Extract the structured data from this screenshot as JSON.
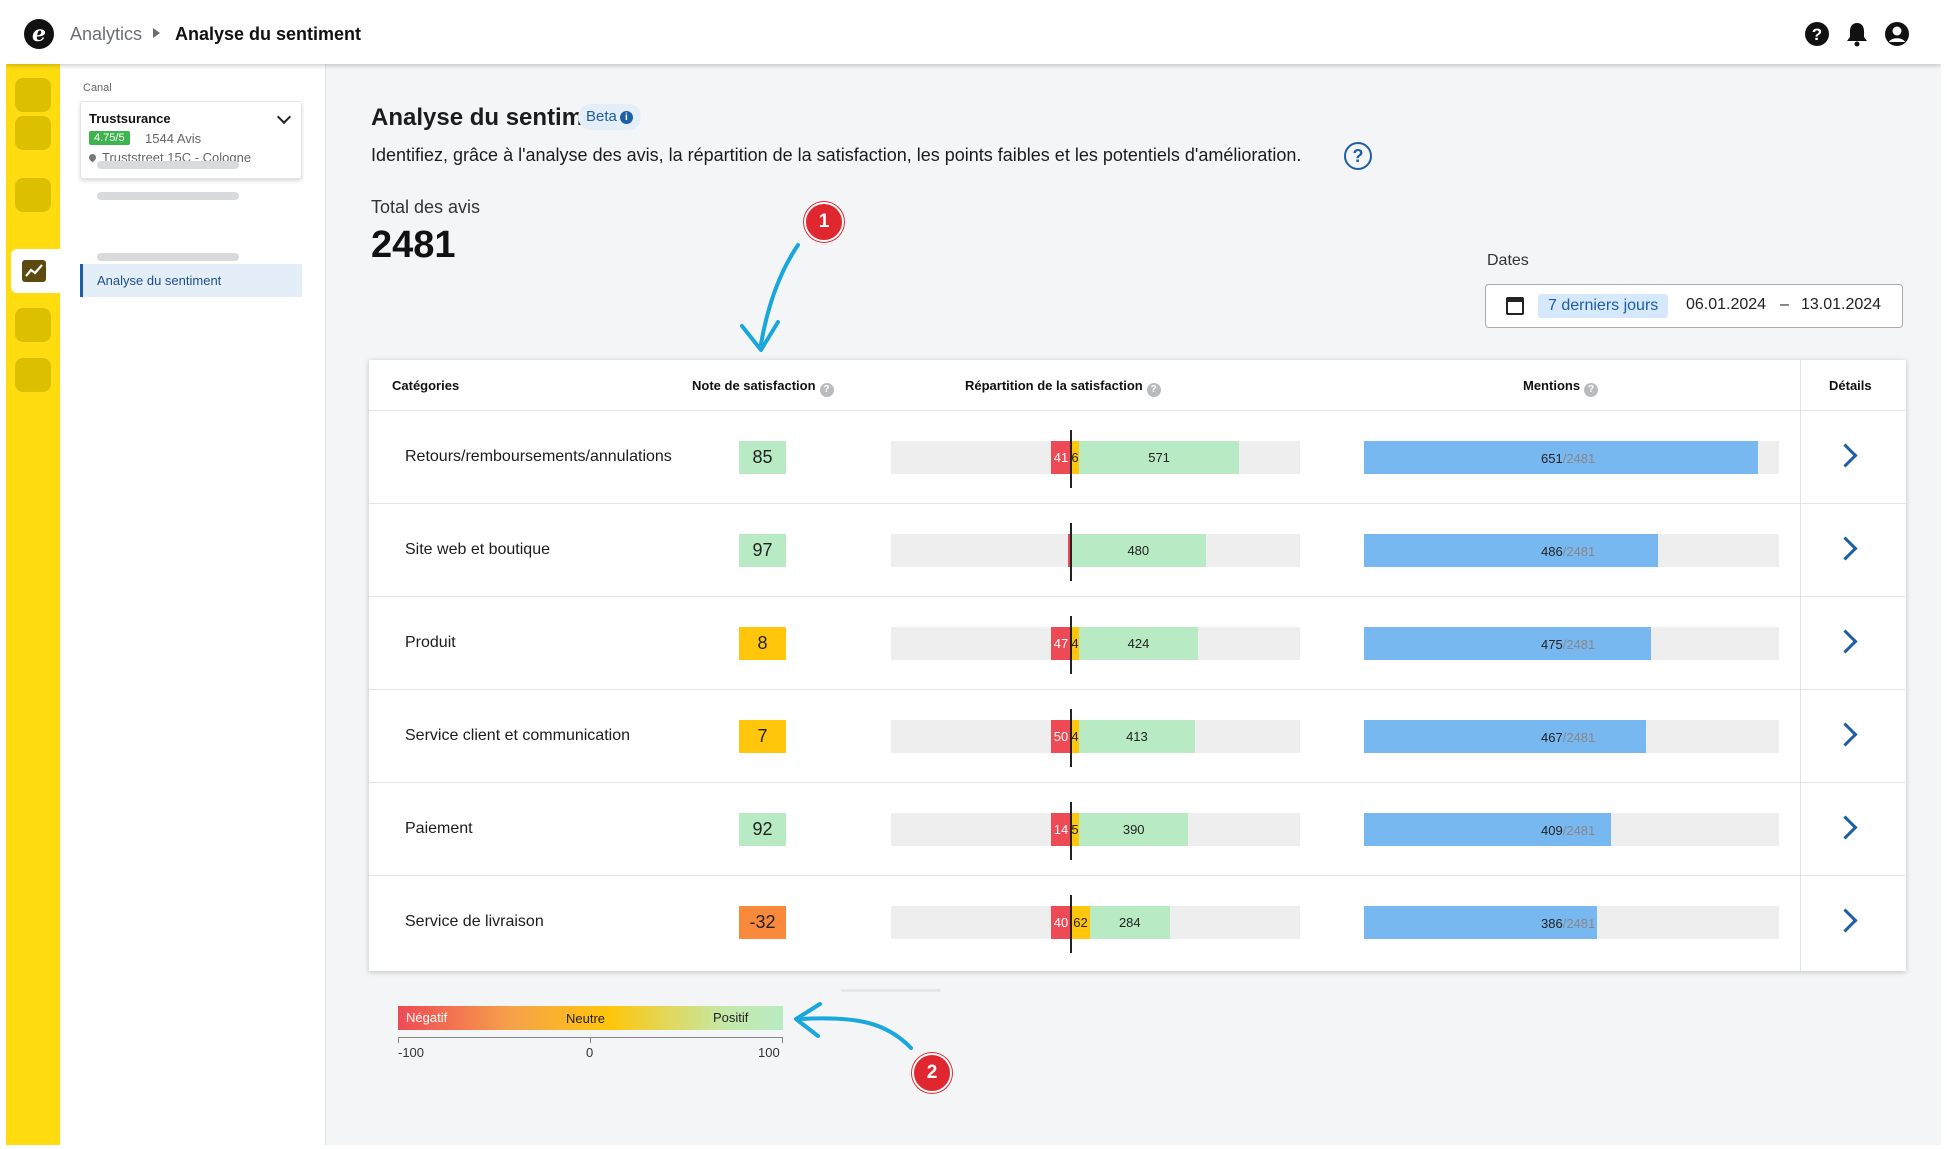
{
  "header": {
    "breadcrumb_root": "Analytics",
    "breadcrumb_current": "Analyse du sentiment",
    "logo_letter": "e",
    "icons": [
      "help-icon",
      "bell-icon",
      "user-icon"
    ]
  },
  "sidebar": {
    "canal_label": "Canal",
    "channel": {
      "name": "Trustsurance",
      "rating": "4.75/5",
      "reviews": "1544 Avis",
      "address": "Truststreet 15C - Cologne"
    },
    "active_item": "Analyse du sentiment"
  },
  "page": {
    "title": "Analyse du sentiment",
    "badge": "Beta",
    "description": "Identifiez, grâce à l'analyse des avis, la répartition de la satisfaction, les points faibles et les potentiels d'amélioration.",
    "help_symbol": "?",
    "total_label": "Total des avis",
    "total_value": "2481"
  },
  "dates": {
    "label": "Dates",
    "preset": "7 derniers jours",
    "start": "06.01.2024",
    "separator": "–",
    "end": "13.01.2024"
  },
  "table": {
    "headers": {
      "category": "Catégories",
      "score": "Note de satisfaction",
      "distribution": "Répartition de la satisfaction",
      "mentions": "Mentions",
      "details": "Détails"
    },
    "total_mentions": 2481,
    "rows": [
      {
        "category": "Retours/remboursements/annulations",
        "score": "85",
        "score_color": "#b8ebc3",
        "negative": "41",
        "neutral": "6",
        "positive": "571",
        "mentions": "651",
        "mentions_total": "/2481"
      },
      {
        "category": "Site web et boutique",
        "score": "97",
        "score_color": "#b8ebc3",
        "negative": "",
        "neutral": "",
        "positive": "480",
        "mentions": "486",
        "mentions_total": "/2481"
      },
      {
        "category": "Produit",
        "score": "8",
        "score_color": "#ffc60b",
        "negative": "47",
        "neutral": "4",
        "positive": "424",
        "mentions": "475",
        "mentions_total": "/2481"
      },
      {
        "category": "Service client et communication",
        "score": "7",
        "score_color": "#ffc60b",
        "negative": "50",
        "neutral": "4",
        "positive": "413",
        "mentions": "467",
        "mentions_total": "/2481"
      },
      {
        "category": "Paiement",
        "score": "92",
        "score_color": "#b8ebc3",
        "negative": "14",
        "neutral": "5",
        "positive": "390",
        "mentions": "409",
        "mentions_total": "/2481"
      },
      {
        "category": "Service de livraison",
        "score": "-32",
        "score_color": "#f98a3c",
        "negative": "40",
        "neutral": "62",
        "positive": "284",
        "mentions": "386",
        "mentions_total": "/2481"
      }
    ]
  },
  "legend": {
    "negative": "Négatif",
    "neutral": "Neutre",
    "positive": "Positif",
    "min": "-100",
    "mid": "0",
    "max": "100"
  },
  "callouts": [
    "1",
    "2"
  ],
  "colors": {
    "brand_yellow": "#ffdc0f",
    "accent_blue": "#1d5ea8",
    "negative": "#ee4a56",
    "neutral": "#ffc60b",
    "positive": "#b8ebc3",
    "mentions": "#78b8f0",
    "callout_red": "#e0262e",
    "arrow_cyan": "#1aa7dc"
  }
}
